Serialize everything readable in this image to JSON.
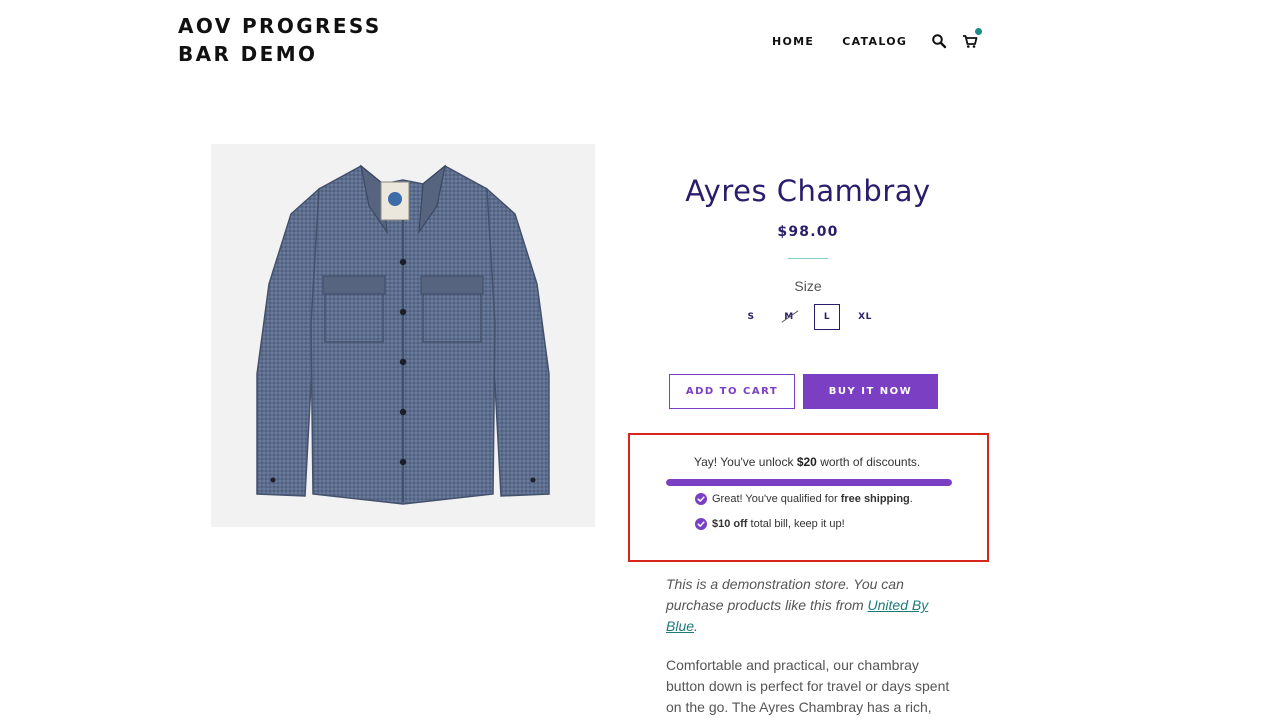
{
  "header": {
    "site_title": "AOV PROGRESS BAR DEMO",
    "nav": [
      "HOME",
      "CATALOG"
    ],
    "icons": [
      "search-icon",
      "cart-icon"
    ],
    "cart_indicator_color": "#1d8a8a"
  },
  "product": {
    "title": "Ayres Chambray",
    "price": "$98.00",
    "size_label": "Size",
    "sizes": [
      {
        "label": "S",
        "state": "available"
      },
      {
        "label": "M",
        "state": "unavailable"
      },
      {
        "label": "L",
        "state": "selected"
      },
      {
        "label": "XL",
        "state": "available"
      }
    ],
    "add_to_cart": "ADD TO CART",
    "buy_it_now": "BUY IT NOW"
  },
  "aov": {
    "headline_prefix": "Yay! You've unlock",
    "headline_amount": "$20",
    "headline_suffix": "worth of discounts.",
    "progress_percent": 100,
    "rewards": [
      {
        "prefix": "Great! You've qualified for",
        "bold": "free shipping",
        "suffix": "."
      },
      {
        "prefix": "",
        "bold": "$10 off",
        "suffix": "total bill, keep it up!"
      }
    ],
    "accent_color": "#7b3fc4",
    "highlight_border_color": "#d7261b"
  },
  "description": {
    "demo_note_prefix": "This is a demonstration store. You can purchase products like this from",
    "demo_note_link": "United By Blue",
    "demo_note_suffix": ".",
    "body": "Comfortable and practical, our chambray button down is perfect for travel or days spent on the go. The Ayres Chambray has a rich,"
  },
  "colors": {
    "brand_purple": "#7b3fc4",
    "title_navy": "#2b1d6b",
    "divider_teal": "#7fd1c4"
  }
}
